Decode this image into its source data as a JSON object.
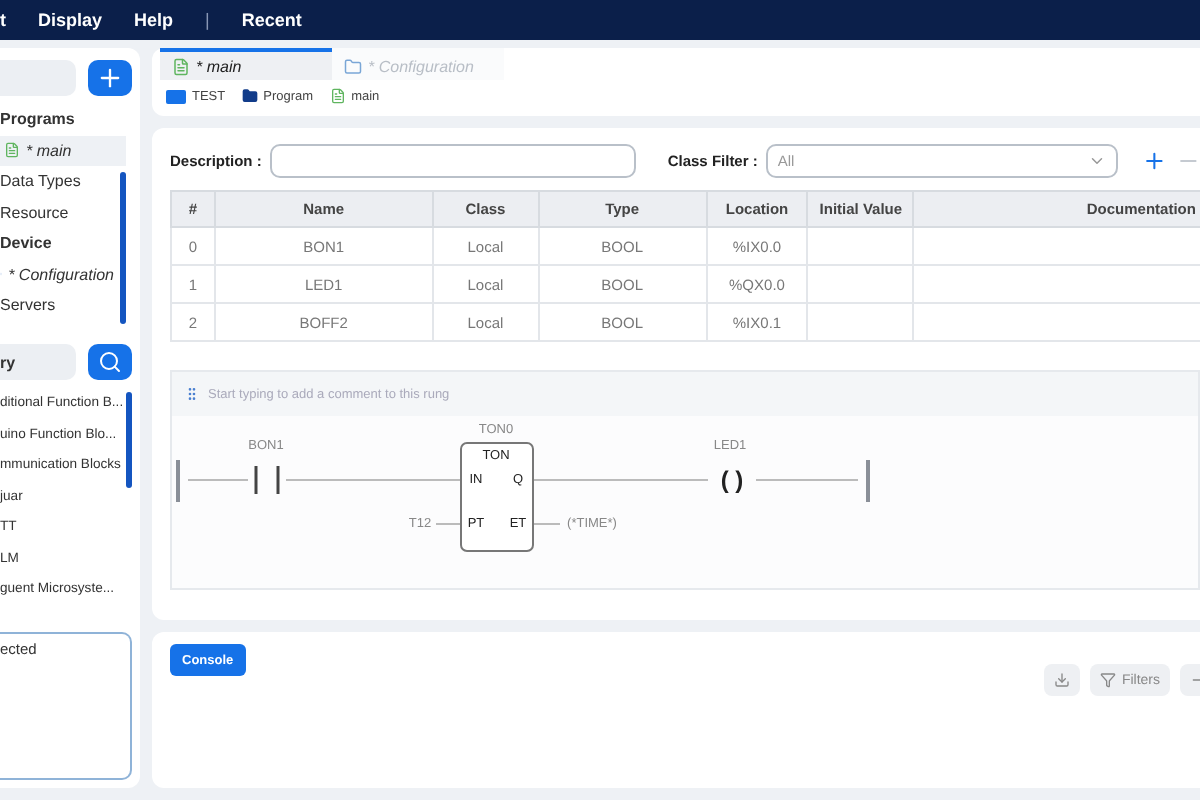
{
  "menu": [
    {
      "label": "t",
      "kind": "item"
    },
    {
      "label": "Display",
      "kind": "item"
    },
    {
      "label": "Help",
      "kind": "item"
    },
    {
      "label": "|",
      "kind": "separator"
    },
    {
      "label": "Recent",
      "kind": "item"
    }
  ],
  "project_tree": [
    {
      "label": "Programs",
      "kind": "heading",
      "selected": false
    },
    {
      "label": "* main",
      "kind": "program",
      "selected": true
    },
    {
      "label": "Data Types",
      "kind": "item",
      "selected": false
    },
    {
      "label": "Resource",
      "kind": "item",
      "selected": false
    },
    {
      "label": "Device",
      "kind": "heading",
      "selected": false
    },
    {
      "label": "* Configuration",
      "kind": "config",
      "selected": false
    },
    {
      "label": "Servers",
      "kind": "item",
      "selected": false
    }
  ],
  "library": {
    "placeholder": "ry",
    "items": [
      "ditional Function B...",
      "uino Function Blo...",
      "mmunication Blocks",
      "juar",
      "TT",
      "LM",
      "guent Microsyste..."
    ]
  },
  "output": {
    "text": "ected"
  },
  "tabs": [
    {
      "label": "* main",
      "selected": true
    },
    {
      "label": "* Configuration",
      "selected": false
    }
  ],
  "breadcrumb": [
    {
      "label": "TEST"
    },
    {
      "label": "Program"
    },
    {
      "label": "main"
    }
  ],
  "editor": {
    "description_label": "Description :",
    "class_filter_label": "Class Filter :",
    "class_filter_value": "All",
    "table": {
      "columns": [
        "#",
        "Name",
        "Class",
        "Type",
        "Location",
        "Initial Value",
        "Documentation"
      ],
      "rows": [
        {
          "index": "0",
          "name": "BON1",
          "class": "Local",
          "type": "BOOL",
          "location": "%IX0.0"
        },
        {
          "index": "1",
          "name": "LED1",
          "class": "Local",
          "type": "BOOL",
          "location": "%QX0.0"
        },
        {
          "index": "2",
          "name": "BOFF2",
          "class": "Local",
          "type": "BOOL",
          "location": "%IX0.1"
        }
      ]
    },
    "rung": {
      "comment_placeholder": "Start typing to add a comment to this rung",
      "contact": {
        "label": "BON1"
      },
      "block": {
        "instance": "TON0",
        "type": "TON",
        "inputs": [
          "IN",
          "PT"
        ],
        "outputs": [
          "Q",
          "ET"
        ],
        "pt_value": "T12",
        "et_value": "(*TIME*)"
      },
      "coil": {
        "label": "LED1",
        "symbol": "( )"
      }
    }
  },
  "console": {
    "button": "Console",
    "filters": "Filters"
  }
}
